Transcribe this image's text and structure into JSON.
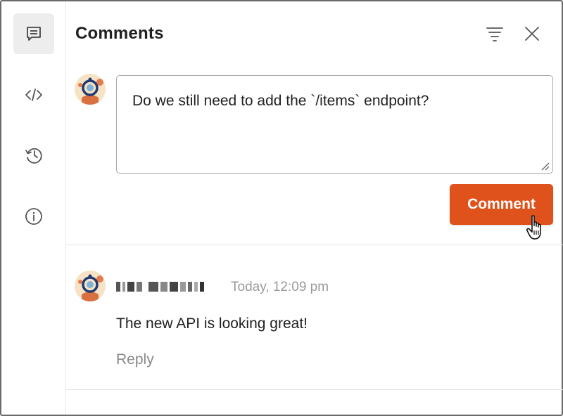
{
  "panel": {
    "title": "Comments"
  },
  "rail": {
    "items": [
      {
        "icon": "comment-icon",
        "active": true
      },
      {
        "icon": "code-icon",
        "active": false
      },
      {
        "icon": "history-icon",
        "active": false
      },
      {
        "icon": "info-icon",
        "active": false
      }
    ]
  },
  "header_actions": {
    "filter_icon": "filter-icon",
    "close_icon": "close-icon"
  },
  "composer": {
    "value": "Do we still need to add the `/items` endpoint?",
    "submit_label": "Comment"
  },
  "thread": {
    "comments": [
      {
        "timestamp": "Today, 12:09 pm",
        "text": "The new API is looking great!",
        "reply_label": "Reply"
      }
    ]
  },
  "colors": {
    "accent": "#e0521c",
    "rail_active_bg": "#ededed",
    "muted_text": "#9a9a9a"
  }
}
